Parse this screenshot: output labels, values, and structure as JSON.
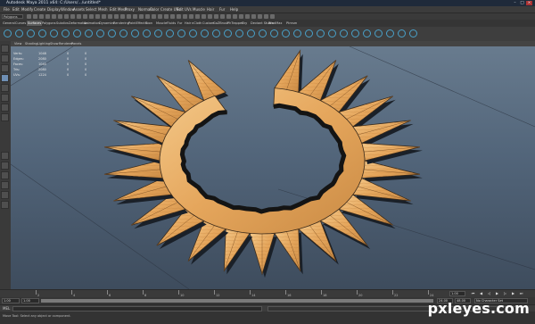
{
  "window": {
    "title": "Autodesk Maya 2011 x64: C:/Users/.../untitled*"
  },
  "menu": {
    "items": [
      "File",
      "Edit",
      "Modify",
      "Create",
      "Display",
      "Window",
      "Assets",
      "Select",
      "Mesh",
      "Edit Mesh",
      "Proxy",
      "Normals",
      "Color",
      "Create UVs",
      "Edit UVs",
      "Muscle",
      "Hair",
      "Fur",
      "Help"
    ]
  },
  "status": {
    "mode": "Polygons"
  },
  "shelf": {
    "tabs": [
      "General",
      "Curves",
      "Surfaces",
      "Polygons",
      "Subdivs",
      "Deformation",
      "Animation",
      "Dynamics",
      "Rendering",
      "PaintEffects",
      "Toon",
      "Muscle",
      "Fluids",
      "Fur",
      "Hair",
      "nCloth",
      "Custom",
      "GoZBrush",
      "PhTrapper",
      "Sky",
      "Deviant Studio",
      "BradMax",
      "Ptrnsm"
    ],
    "active_tab": "Surfaces"
  },
  "panel_menu": [
    "View",
    "Shading",
    "Lighting",
    "Show",
    "Renderer",
    "Panels"
  ],
  "hud": {
    "rows": [
      {
        "label": "Verts:",
        "v1": "1048",
        "v2": "0",
        "v3": "0"
      },
      {
        "label": "Edges:",
        "v1": "2080",
        "v2": "0",
        "v3": "0"
      },
      {
        "label": "Faces:",
        "v1": "1040",
        "v2": "0",
        "v3": "0"
      },
      {
        "label": "Tris:",
        "v1": "2080",
        "v2": "0",
        "v3": "0"
      },
      {
        "label": "UVs:",
        "v1": "1224",
        "v2": "0",
        "v3": "0"
      }
    ]
  },
  "timeline": {
    "ticks": [
      "2",
      "4",
      "6",
      "8",
      "10",
      "12",
      "14",
      "16",
      "18",
      "20",
      "22",
      "24"
    ],
    "current_frame": "1.00"
  },
  "range": {
    "start": "1.00",
    "start2": "1.00",
    "end": "24.00",
    "end2": "48.00",
    "char_set": "No Character Set"
  },
  "command": {
    "label": "MEL"
  },
  "help": {
    "text": "Move Tool: Select any object or component."
  },
  "watermark": "pxleyes.com"
}
